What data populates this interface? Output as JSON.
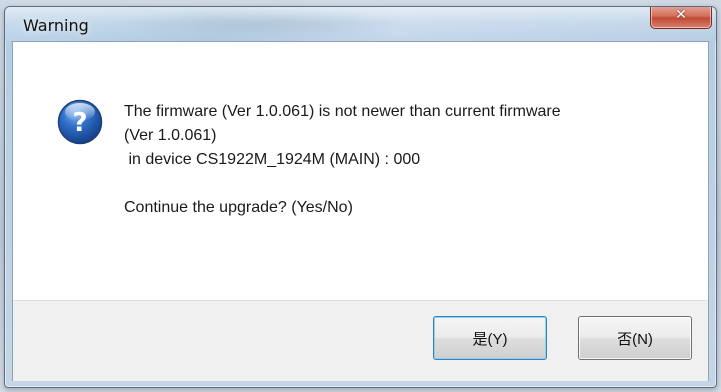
{
  "window": {
    "title": "Warning",
    "close_symbol": "✕"
  },
  "message": {
    "icon": "question-icon",
    "lines": [
      "The firmware (Ver 1.0.061) is not newer than current firmware",
      "(Ver 1.0.061)",
      " in device CS1922M_1924M (MAIN) : 000",
      "Continue the upgrade? (Yes/No)"
    ]
  },
  "buttons": {
    "yes_label": "是(Y)",
    "no_label": "否(N)"
  },
  "colors": {
    "icon_blue": "#1f5fb8",
    "close_red": "#c24a35"
  }
}
